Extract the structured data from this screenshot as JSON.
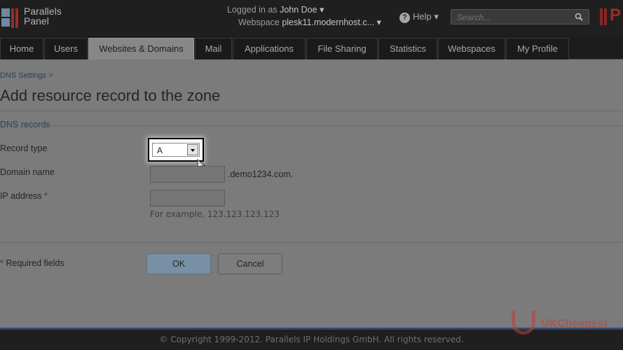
{
  "header": {
    "logo_line1": "Parallels",
    "logo_line2": "Panel",
    "logged_in_label": "Logged in as",
    "user_name": "John Doe",
    "webspace_label": "Webspace",
    "webspace_value": "plesk11.modernhost.c...",
    "help_label": "Help",
    "search_placeholder": "Search..."
  },
  "nav": {
    "tabs": [
      {
        "label": "Home",
        "active": false
      },
      {
        "label": "Users",
        "active": false
      },
      {
        "label": "Websites & Domains",
        "active": true
      },
      {
        "label": "Mail",
        "active": false
      },
      {
        "label": "Applications",
        "active": false
      },
      {
        "label": "File Sharing",
        "active": false
      },
      {
        "label": "Statistics",
        "active": false
      },
      {
        "label": "Webspaces",
        "active": false
      },
      {
        "label": "My Profile",
        "active": false
      }
    ]
  },
  "main": {
    "breadcrumb": "DNS Settings >",
    "page_title": "Add resource record to the zone",
    "section_title": "DNS records",
    "form": {
      "record_type_label": "Record type",
      "record_type_value": "A",
      "domain_name_label": "Domain name",
      "domain_name_value": "",
      "domain_suffix": ".demo1234.com.",
      "ip_address_label": "IP address",
      "ip_address_value": "",
      "ip_hint": "For example, 123.123.123.123",
      "required_marker": "*"
    },
    "required_fields_label": "Required fields",
    "ok_label": "OK",
    "cancel_label": "Cancel"
  },
  "footer": {
    "copyright": "© Copyright 1999-2012. Parallels IP Holdings GmbH. All rights reserved."
  },
  "watermark": {
    "text": "UKCheapest"
  },
  "colors": {
    "accent_blue": "#2c4c73",
    "brand_red": "#9b2b2b",
    "required_red": "#7a1d1d"
  }
}
